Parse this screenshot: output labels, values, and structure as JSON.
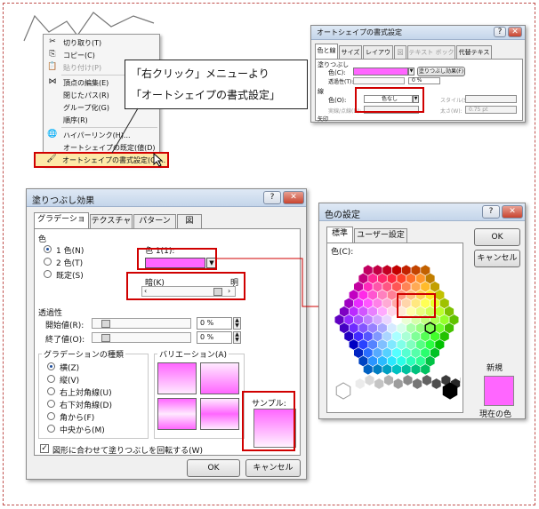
{
  "context_menu": {
    "items": [
      {
        "icon": "✂",
        "label": "切り取り(T)"
      },
      {
        "icon": "⎘",
        "label": "コピー(C)"
      },
      {
        "icon": "📋",
        "label": "貼り付け(P)"
      },
      {
        "icon": "⋈",
        "label": "頂点の編集(E)"
      },
      {
        "icon": "",
        "label": "閉じたパス(R)"
      },
      {
        "icon": "",
        "label": "グループ化(G)"
      },
      {
        "icon": "",
        "label": "順序(R)"
      },
      {
        "icon": "🌐",
        "label": "ハイパーリンク(H)..."
      },
      {
        "icon": "",
        "label": "オートシェイプの既定(値(D)"
      },
      {
        "icon": "🖌",
        "label": "オートシェイプの書式設定(O)..."
      }
    ]
  },
  "callout": {
    "line1": "「右クリック」メニューより",
    "line2": "「オートシェイプの書式設定」"
  },
  "format_dialog": {
    "title": "オートシェイプの書式設定",
    "tabs": [
      "色と線",
      "サイズ",
      "レイアウト",
      "図",
      "テキスト ボックス",
      "代替テキスト"
    ],
    "fill_section": "塗りつぶし",
    "fill_color_label": "色(C):",
    "fill_effects_button": "塗りつぶし効果(F)",
    "transparency_label": "透過性(T):",
    "transparency_value": "0 %",
    "line_section": "線",
    "line_color_label": "色(O):",
    "line_color_value": "色なし",
    "line_style_label": "スタイル(S):",
    "dash_label": "実線/点線(D):",
    "weight_label": "太さ(W):",
    "weight_value": "0.75 pt",
    "arrow_section": "矢印"
  },
  "fill_effects": {
    "title": "塗りつぶし効果",
    "help": "?",
    "close": "✕",
    "tabs": [
      "グラデーション",
      "テクスチャ",
      "パターン",
      "図"
    ],
    "color_section": "色",
    "options": [
      "1 色(N)",
      "2 色(T)",
      "既定(S)"
    ],
    "color1_label": "色 1(1):",
    "dark_label": "暗(K)",
    "light_label": "明",
    "transparency_section": "透過性",
    "start_label": "開始値(R):",
    "start_value": "0 %",
    "end_label": "終了値(O):",
    "end_value": "0 %",
    "shading_section": "グラデーションの種類",
    "shading_styles": [
      "横(Z)",
      "縦(V)",
      "右上対角線(U)",
      "右下対角線(D)",
      "角から(F)",
      "中央から(M)"
    ],
    "variants_label": "バリエーション(A)",
    "sample_label": "サンプル:",
    "rotate_label": "図形に合わせて塗りつぶしを回転する(W)",
    "ok": "OK",
    "cancel": "キャンセル"
  },
  "colors_dialog": {
    "title": "色の設定",
    "help": "?",
    "close": "✕",
    "tabs": [
      "標準",
      "ユーザー設定"
    ],
    "colors_label": "色(C):",
    "ok": "OK",
    "cancel": "キャンセル",
    "new_label": "新規",
    "current_label": "現在の色"
  },
  "colors": {
    "accent_red": "#d00000",
    "pink": "#ff66ff",
    "pink_light": "#ffccff"
  }
}
